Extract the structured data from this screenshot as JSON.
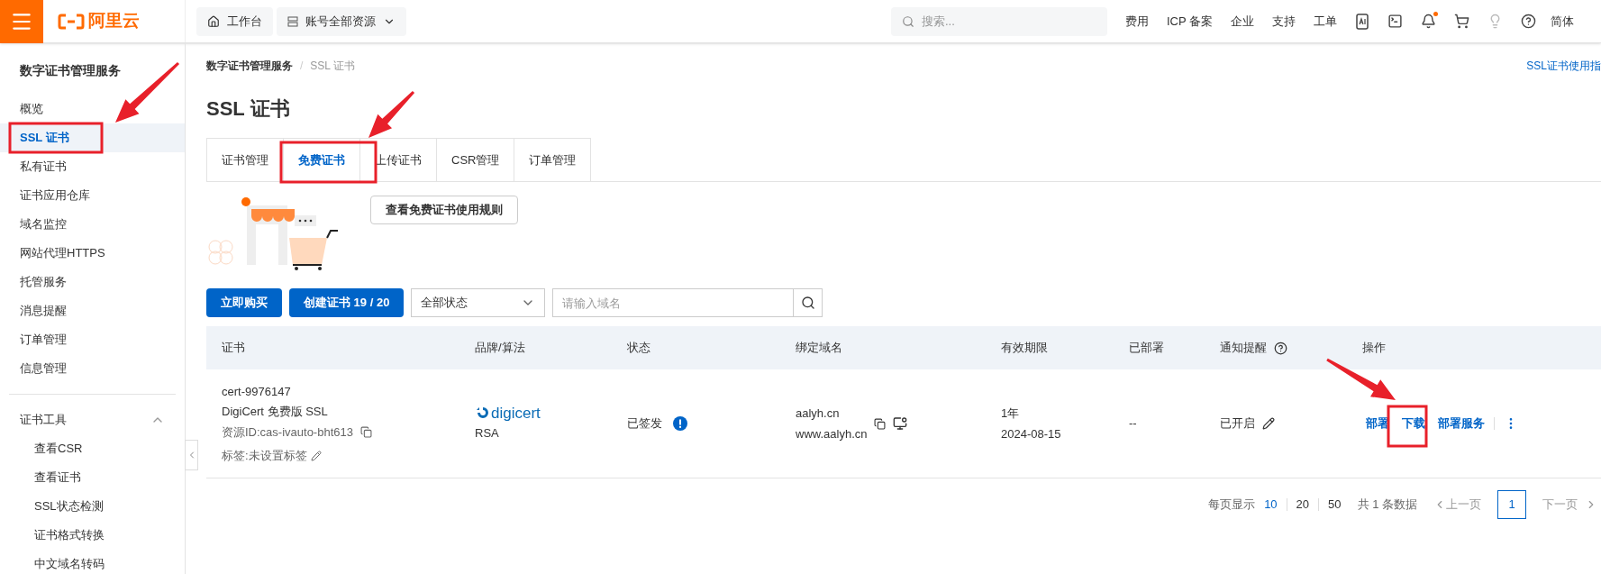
{
  "topbar": {
    "brand": "阿里云",
    "workbench": "工作台",
    "resources": "账号全部资源",
    "search_placeholder": "搜索...",
    "links": [
      "费用",
      "ICP 备案",
      "企业",
      "支持",
      "工单"
    ],
    "language": "简体"
  },
  "sidebar": {
    "title": "数字证书管理服务",
    "items": [
      {
        "label": "概览",
        "selected": false
      },
      {
        "label": "SSL 证书",
        "selected": true
      },
      {
        "label": "私有证书",
        "selected": false
      },
      {
        "label": "证书应用仓库",
        "selected": false
      },
      {
        "label": "域名监控",
        "selected": false
      },
      {
        "label": "网站代理HTTPS",
        "selected": false
      },
      {
        "label": "托管服务",
        "selected": false
      },
      {
        "label": "消息提醒",
        "selected": false
      },
      {
        "label": "订单管理",
        "selected": false
      },
      {
        "label": "信息管理",
        "selected": false
      }
    ],
    "section": {
      "label": "证书工具",
      "expanded": true,
      "items": [
        "查看CSR",
        "查看证书",
        "SSL状态检测",
        "证书格式转换",
        "中文域名转码"
      ]
    }
  },
  "breadcrumb": [
    "数字证书管理服务",
    "SSL 证书"
  ],
  "breadcrumb_separator": "/",
  "help_link": "SSL证书使用指",
  "title": "SSL 证书",
  "tabs": [
    {
      "label": "证书管理",
      "selected": false
    },
    {
      "label": "免费证书",
      "selected": true
    },
    {
      "label": "上传证书",
      "selected": false
    },
    {
      "label": "CSR管理",
      "selected": false
    },
    {
      "label": "订单管理",
      "selected": false
    }
  ],
  "rules_button": "查看免费证书使用规则",
  "toolbar": {
    "buy": "立即购买",
    "create": "创建证书 19 / 20",
    "status_select": "全部状态",
    "search_placeholder": "请输入域名"
  },
  "table": {
    "columns": [
      "证书",
      "品牌/算法",
      "状态",
      "绑定域名",
      "有效期限",
      "已部署",
      "通知提醒",
      "操作"
    ],
    "rows": [
      {
        "cert_id": "cert-9976147",
        "cert_name": "DigiCert 免费版 SSL",
        "resource_id": "资源ID:cas-ivauto-bht613",
        "tags": "标签:未设置标签",
        "brand": "digicert",
        "algorithm": "RSA",
        "status": "已签发",
        "domains": [
          "aalyh.cn",
          "www.aalyh.cn"
        ],
        "duration": "1年",
        "expiry": "2024-08-15",
        "deployed": "--",
        "notify": "已开启",
        "actions": [
          "部署",
          "下载",
          "部署服务"
        ]
      }
    ]
  },
  "pagination": {
    "label": "每页显示",
    "sizes": [
      {
        "label": "10",
        "selected": true
      },
      {
        "label": "20",
        "selected": false
      },
      {
        "label": "50",
        "selected": false
      }
    ],
    "total": "共 1 条数据",
    "prev": "上一页",
    "pages": [
      {
        "label": "1",
        "selected": true
      }
    ],
    "next": "下一页"
  }
}
